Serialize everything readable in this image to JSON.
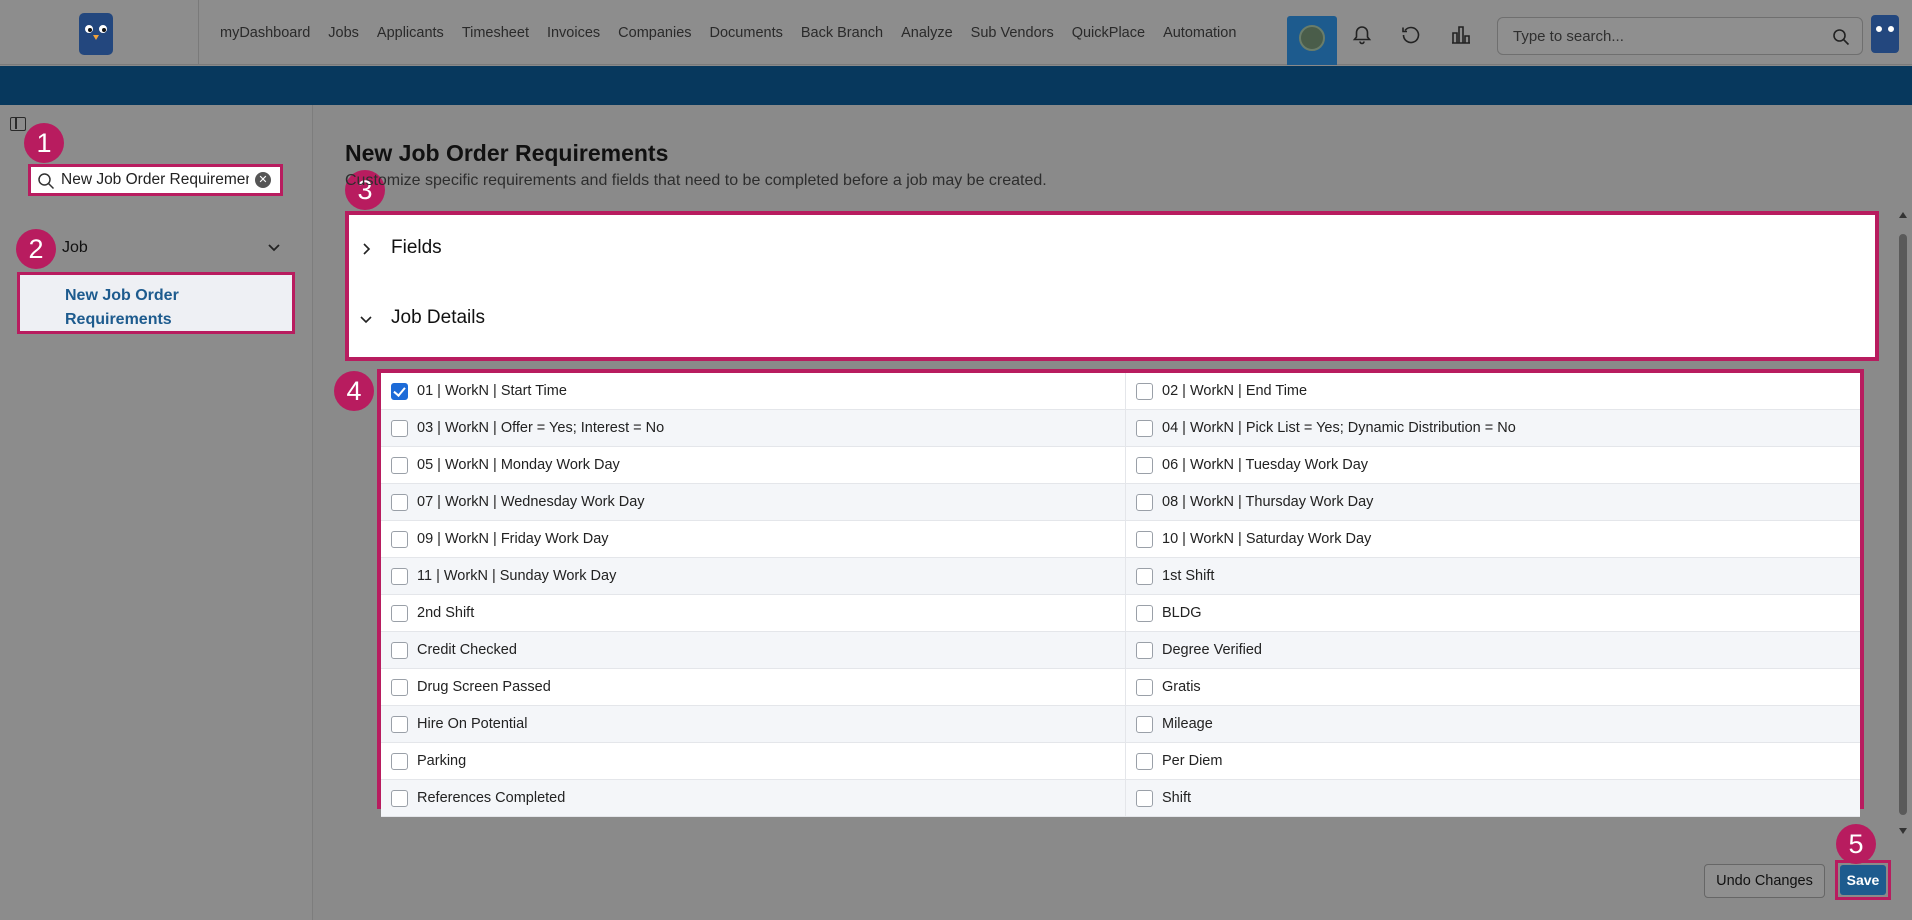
{
  "nav": {
    "links": [
      "myDashboard",
      "Jobs",
      "Applicants",
      "Timesheet",
      "Invoices",
      "Companies",
      "Documents",
      "Back Branch",
      "Analyze",
      "Sub Vendors",
      "QuickPlace",
      "Automation"
    ],
    "search_placeholder": "Type to search..."
  },
  "sidebar": {
    "search_value": "New Job Order Requirements",
    "group_label": "Job",
    "item_label": "New Job Order Requirements"
  },
  "badges": [
    "1",
    "2",
    "3",
    "4",
    "5"
  ],
  "main": {
    "title": "New Job Order Requirements",
    "subtitle": "Customize specific requirements and fields that need to be completed before a job may be created.",
    "sections": [
      {
        "label": "Fields",
        "expanded": false
      },
      {
        "label": "Job Details",
        "expanded": true
      }
    ],
    "options": [
      [
        {
          "label": "01 | WorkN | Start Time",
          "checked": true
        },
        {
          "label": "02 | WorkN | End Time",
          "checked": false
        }
      ],
      [
        {
          "label": "03 | WorkN | Offer = Yes; Interest = No",
          "checked": false
        },
        {
          "label": "04 | WorkN | Pick List = Yes; Dynamic Distribution = No",
          "checked": false
        }
      ],
      [
        {
          "label": "05 | WorkN | Monday Work Day",
          "checked": false
        },
        {
          "label": "06 | WorkN | Tuesday Work Day",
          "checked": false
        }
      ],
      [
        {
          "label": "07 | WorkN | Wednesday Work Day",
          "checked": false
        },
        {
          "label": "08 | WorkN | Thursday Work Day",
          "checked": false
        }
      ],
      [
        {
          "label": "09 | WorkN | Friday Work Day",
          "checked": false
        },
        {
          "label": "10 | WorkN | Saturday Work Day",
          "checked": false
        }
      ],
      [
        {
          "label": "11 | WorkN | Sunday Work Day",
          "checked": false
        },
        {
          "label": "1st Shift",
          "checked": false
        }
      ],
      [
        {
          "label": "2nd Shift",
          "checked": false
        },
        {
          "label": "BLDG",
          "checked": false
        }
      ],
      [
        {
          "label": "Credit Checked",
          "checked": false
        },
        {
          "label": "Degree Verified",
          "checked": false
        }
      ],
      [
        {
          "label": "Drug Screen Passed",
          "checked": false
        },
        {
          "label": "Gratis",
          "checked": false
        }
      ],
      [
        {
          "label": "Hire On Potential",
          "checked": false
        },
        {
          "label": "Mileage",
          "checked": false
        }
      ],
      [
        {
          "label": "Parking",
          "checked": false
        },
        {
          "label": "Per Diem",
          "checked": false
        }
      ],
      [
        {
          "label": "References Completed",
          "checked": false
        },
        {
          "label": "Shift",
          "checked": false
        }
      ]
    ]
  },
  "footer": {
    "undo_label": "Undo Changes",
    "save_label": "Save"
  },
  "colors": {
    "highlight": "#b81c5f",
    "brand_blue": "#07385d",
    "link_blue": "#1d5b8e",
    "checkbox_on": "#1d6bd8"
  }
}
